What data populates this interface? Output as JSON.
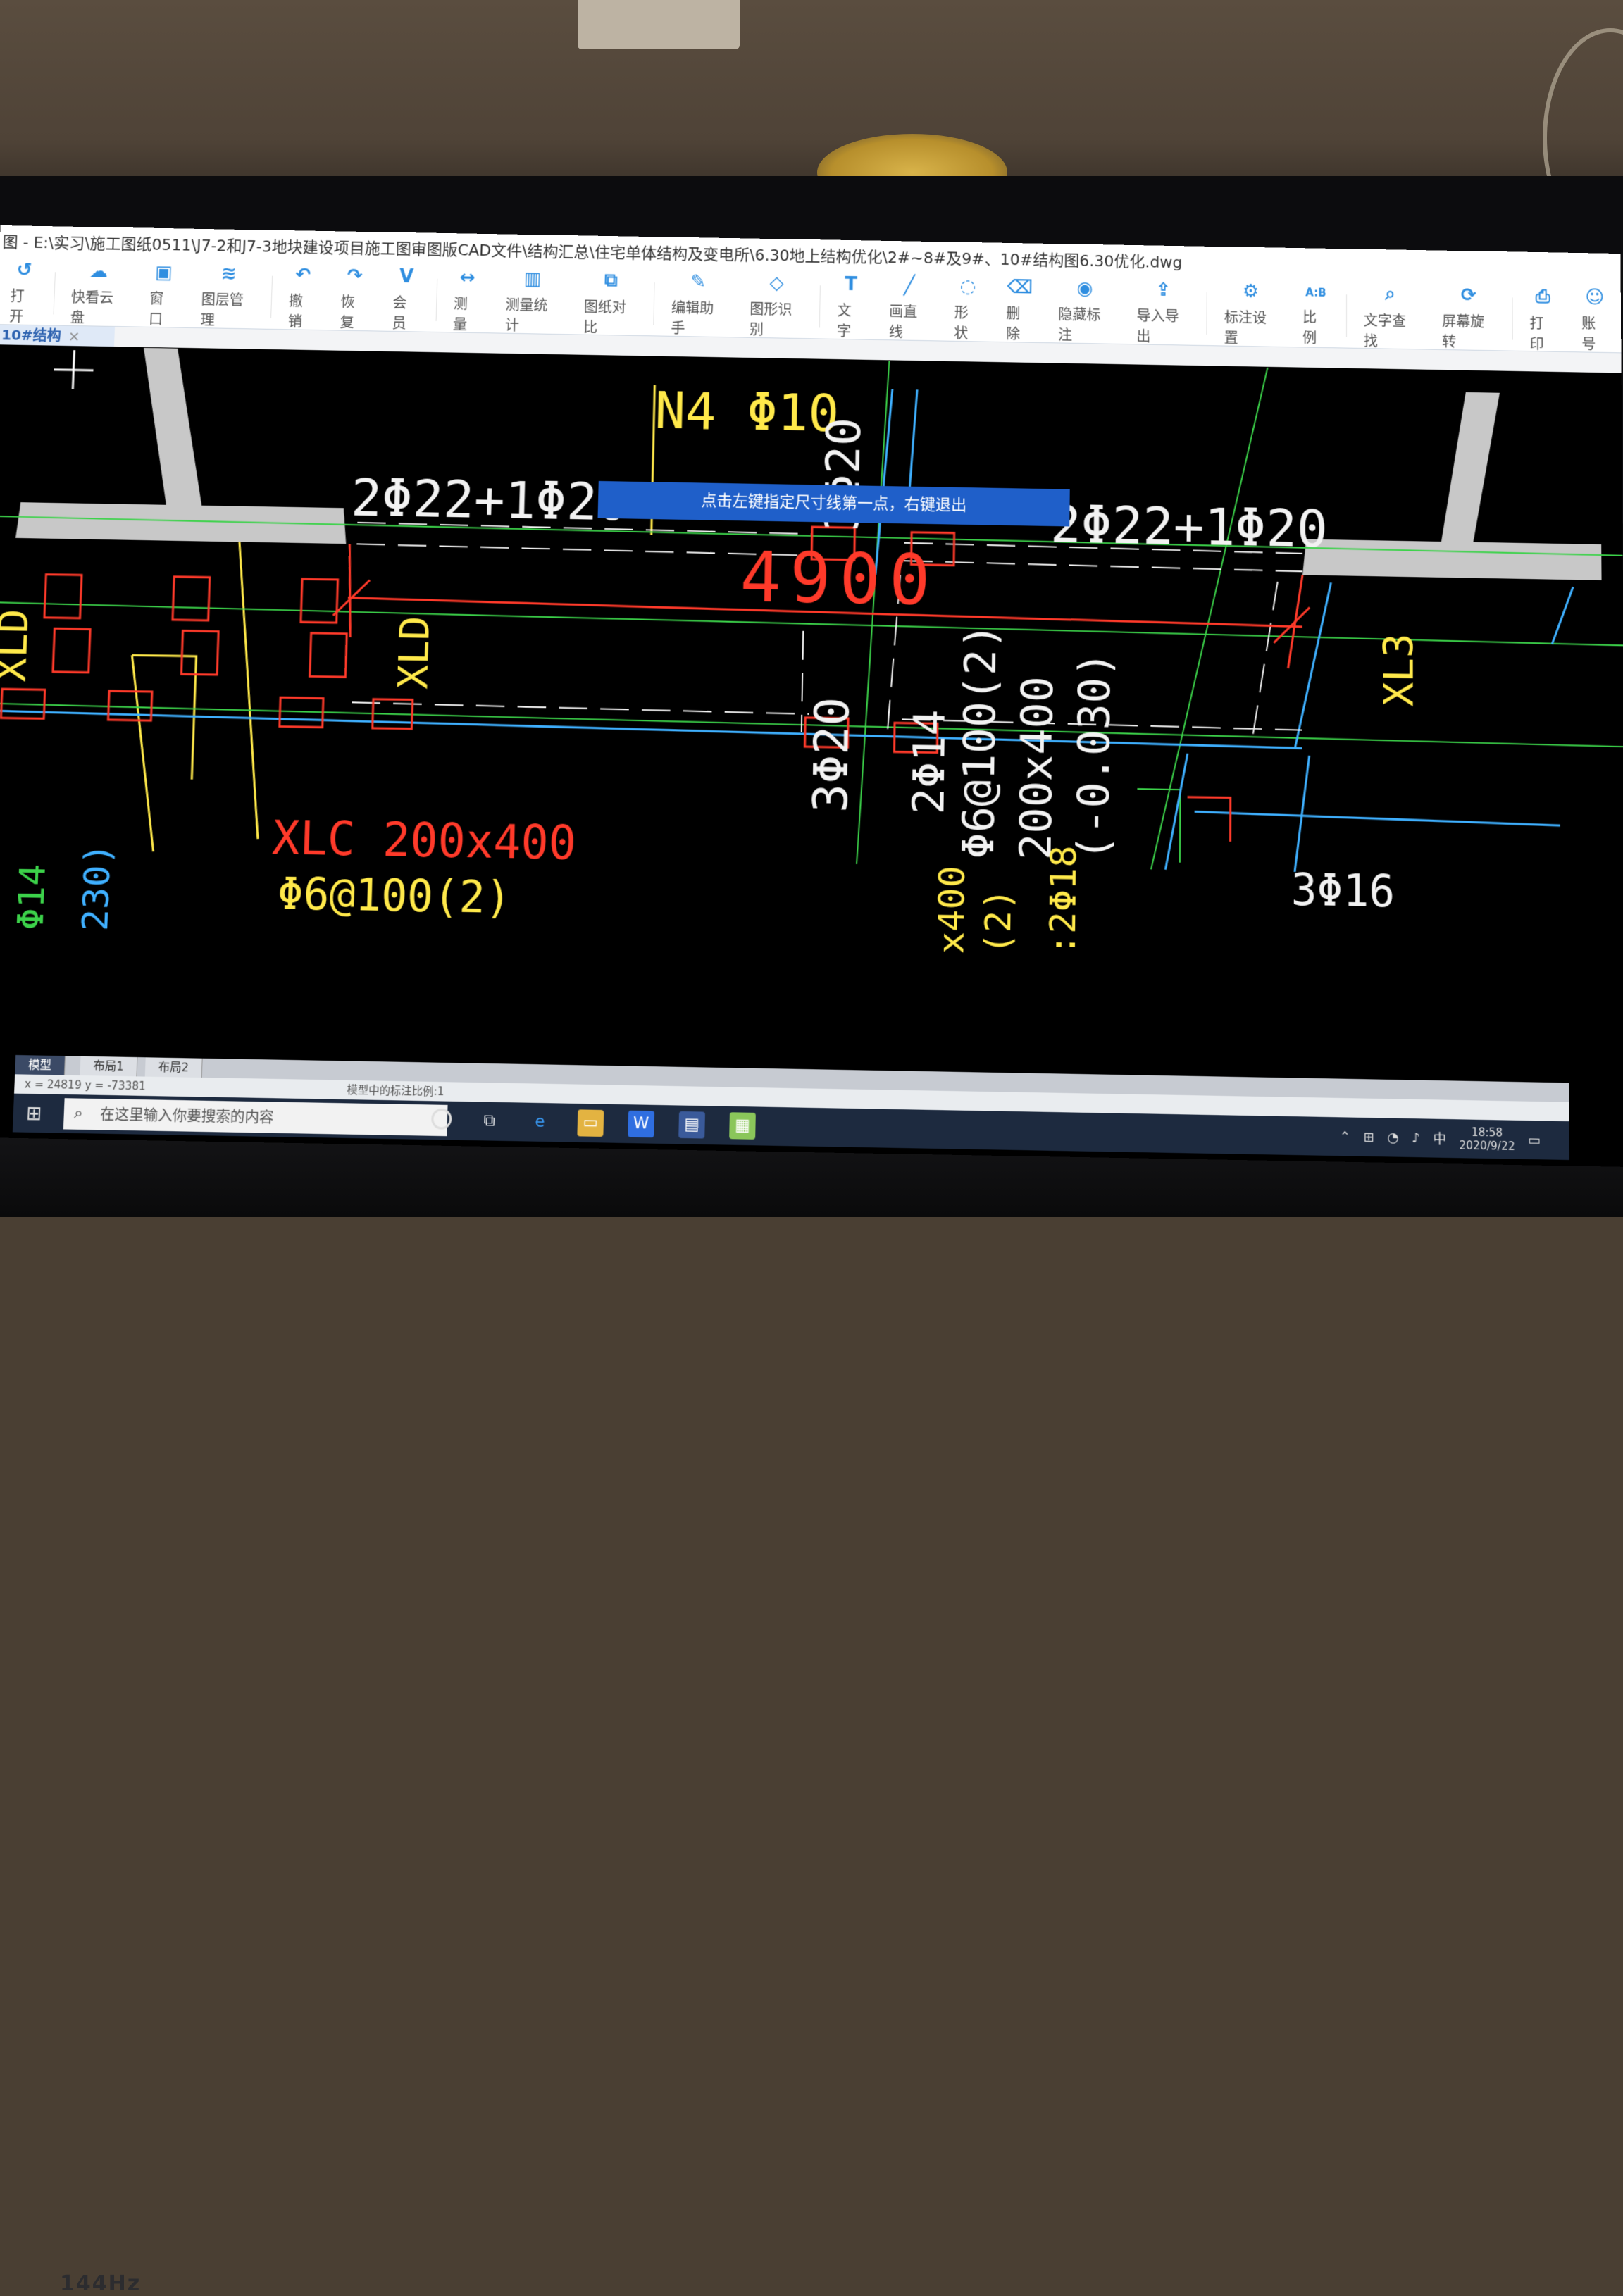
{
  "window": {
    "title": "图 - E:\\实习\\施工图纸0511\\J7-2和J7-3地块建设项目施工图审图版CAD文件\\结构汇总\\住宅单体结构及变电所\\6.30地上结构优化\\2#~8#及9#、10#结构图6.30优化.dwg"
  },
  "toolbar": {
    "items": [
      {
        "label": "打开",
        "icon": "open-icon",
        "glyph": "↺"
      },
      {
        "label": "快看云盘",
        "icon": "cloud-icon",
        "glyph": "☁"
      },
      {
        "label": "窗口",
        "icon": "window-icon",
        "glyph": "▣"
      },
      {
        "label": "图层管理",
        "icon": "layers-icon",
        "glyph": "≋"
      },
      {
        "label": "撤销",
        "icon": "undo-icon",
        "glyph": "↶"
      },
      {
        "label": "恢复",
        "icon": "redo-icon",
        "glyph": "↷"
      },
      {
        "label": "会员",
        "icon": "vip-icon",
        "glyph": "V"
      },
      {
        "label": "测量",
        "icon": "measure-icon",
        "glyph": "↔"
      },
      {
        "label": "测量统计",
        "icon": "measure-stats-icon",
        "glyph": "▥"
      },
      {
        "label": "图纸对比",
        "icon": "compare-icon",
        "glyph": "⧉"
      },
      {
        "label": "编辑助手",
        "icon": "edit-assistant-icon",
        "glyph": "✎"
      },
      {
        "label": "图形识别",
        "icon": "shape-recognition-icon",
        "glyph": "◇"
      },
      {
        "label": "文字",
        "icon": "text-icon",
        "glyph": "T"
      },
      {
        "label": "画直线",
        "icon": "line-icon",
        "glyph": "╱"
      },
      {
        "label": "形状",
        "icon": "shape-icon",
        "glyph": "◌"
      },
      {
        "label": "删除",
        "icon": "eraser-icon",
        "glyph": "⌫"
      },
      {
        "label": "隐藏标注",
        "icon": "hide-annotation-icon",
        "glyph": "◉"
      },
      {
        "label": "导入导出",
        "icon": "import-export-icon",
        "glyph": "⇪"
      },
      {
        "label": "标注设置",
        "icon": "annotation-settings-icon",
        "glyph": "⚙"
      },
      {
        "label": "比例",
        "icon": "scale-icon",
        "glyph": "A:B"
      },
      {
        "label": "文字查找",
        "icon": "text-search-icon",
        "glyph": "⌕"
      },
      {
        "label": "屏幕旋转",
        "icon": "rotate-screen-icon",
        "glyph": "⟳"
      },
      {
        "label": "打印",
        "icon": "print-icon",
        "glyph": "⎙"
      },
      {
        "label": "账号",
        "icon": "account-icon",
        "glyph": "☺"
      }
    ]
  },
  "tab": {
    "label": "10#结构",
    "close": "×"
  },
  "hint": "点击左键指定尺寸线第一点，右键退出",
  "drawing": {
    "labels": {
      "n4": "N4 Φ10",
      "top_left_rebar": "2Φ22+1Φ20",
      "top_right_rebar": "2Φ22+1Φ20",
      "mid_top_rebar": "3Φ20",
      "dimension": "4900",
      "mid_bottom_rebar": "3Φ20",
      "beam_a": "2Φ14",
      "beam_b": "Φ6@100(2)",
      "beam_c": "200x400",
      "beam_d": "(-0.030)",
      "xld_left": "XLD",
      "xld_mid": "XLD",
      "xl3": "XL3",
      "xlc": "XLC 200x400",
      "xlc_stirrup": "Φ6@100(2)",
      "bottom_right_rebar": "3Φ16",
      "bottom_frag_1": "Φ14",
      "bottom_frag_2": "230)",
      "bottom_frag_3": "x400",
      "bottom_frag_4": "(2)",
      "bottom_frag_5": ":2Φ18"
    },
    "colors": {
      "wall": "#c8c8c8",
      "red": "#ff3a2a",
      "yellow": "#ffe94a",
      "white": "#f2f2f2",
      "cyan": "#3fb0ff",
      "green": "#3cd24a"
    }
  },
  "layout_tabs": [
    "模型",
    "布局1",
    "布局2"
  ],
  "status": {
    "coords": "x = 24819 y = -73381",
    "scale": "模型中的标注比例:1"
  },
  "taskbar": {
    "search_placeholder": "在这里输入你要搜索的内容",
    "ime": "中",
    "time": "18:58",
    "date": "2020/9/22"
  },
  "monitor": {
    "badge": "144Hz"
  }
}
